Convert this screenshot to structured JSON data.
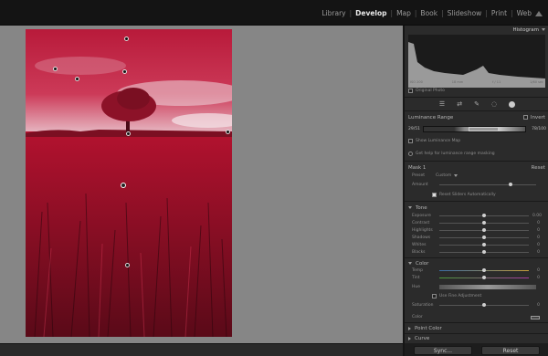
{
  "modules": [
    "Library",
    "Develop",
    "Map",
    "Book",
    "Slideshow",
    "Print",
    "Web"
  ],
  "active_module": "Develop",
  "histogram": {
    "title": "Histogram",
    "ticks": [
      "ISO 200",
      "18 mm",
      "f / 11",
      "1/60 sec"
    ],
    "original_photo_label": "Original Photo"
  },
  "luminance": {
    "label": "Luminance Range",
    "invert_label": "Invert",
    "min": "29/51",
    "max": "78/100",
    "show_map_label": "Show Luminance Map",
    "help_label": "Get help for luminance range masking"
  },
  "mask": {
    "label": "Mask 1",
    "reset_label": "Reset",
    "preset_label": "Preset",
    "preset_value": "Custom",
    "amount_label": "Amount",
    "reset_sliders_label": "Reset Sliders Automatically"
  },
  "tone": {
    "header": "Tone",
    "sliders": [
      {
        "label": "Exposure",
        "value": "0.00",
        "pos": 0.5
      },
      {
        "label": "Contrast",
        "value": "0",
        "pos": 0.5
      },
      {
        "label": "Highlights",
        "value": "0",
        "pos": 0.5
      },
      {
        "label": "Shadows",
        "value": "0",
        "pos": 0.5
      },
      {
        "label": "Whites",
        "value": "0",
        "pos": 0.5
      },
      {
        "label": "Blacks",
        "value": "0",
        "pos": 0.5
      }
    ]
  },
  "color": {
    "header": "Color",
    "temp_label": "Temp",
    "tint_label": "Tint",
    "hue_label": "Hue",
    "fine_label": "Use Fine Adjustment",
    "saturation_label": "Saturation",
    "color_label": "Color"
  },
  "collapsed": [
    "Point Color",
    "Curve"
  ],
  "buttons": {
    "sync": "Sync...",
    "reset": "Reset"
  }
}
